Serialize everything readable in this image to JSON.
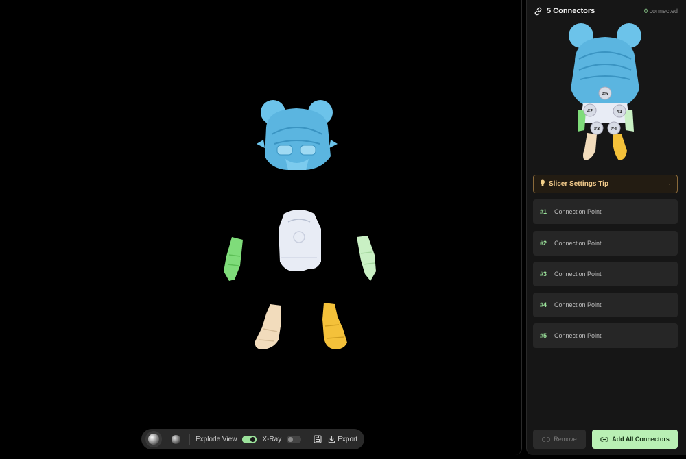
{
  "toolbar": {
    "explode_label": "Explode View",
    "explode_on": true,
    "xray_label": "X-Ray",
    "xray_on": false,
    "export_label": "Export"
  },
  "panel": {
    "title": "5 Connectors",
    "connected_count": "0",
    "connected_suffix": " connected",
    "tip_title": "Slicer Settings Tip",
    "preview_markers": [
      "#5",
      "#2",
      "#1",
      "#3",
      "#4"
    ],
    "connection_points": [
      {
        "num": "#1",
        "label": "Connection Point"
      },
      {
        "num": "#2",
        "label": "Connection Point"
      },
      {
        "num": "#3",
        "label": "Connection Point"
      },
      {
        "num": "#4",
        "label": "Connection Point"
      },
      {
        "num": "#5",
        "label": "Connection Point"
      }
    ],
    "remove_label": "Remove",
    "add_all_label": "Add All Connectors"
  },
  "colors": {
    "head": "#6cc3ea",
    "body": "#e8ecf5",
    "left_arm": "#7fdc7a",
    "right_arm": "#c9f0c4",
    "left_foot": "#f2dcbc",
    "right_foot": "#f4c13a",
    "accent_green": "#9be29b",
    "tip_border": "#8a6a3a"
  }
}
